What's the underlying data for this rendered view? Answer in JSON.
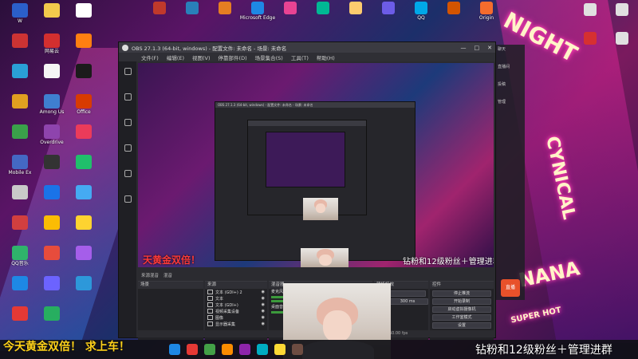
{
  "desktop": {
    "left_icons": [
      {
        "label": "W",
        "color": "#2b5fc9"
      },
      {
        "label": "",
        "color": "#c33"
      },
      {
        "label": "",
        "color": "#2a9fd6"
      },
      {
        "label": "",
        "color": "#e0a020"
      },
      {
        "label": "",
        "color": "#3aa04a"
      },
      {
        "label": "Mobile Ex",
        "color": "#4468c4"
      },
      {
        "label": "",
        "color": "#c9c9c9"
      },
      {
        "label": "",
        "color": "#d23f3f"
      },
      {
        "label": "QQ音乐",
        "color": "#2fb36b"
      },
      {
        "label": "",
        "color": "#1e88e5"
      },
      {
        "label": "",
        "color": "#e53935"
      },
      {
        "label": "",
        "color": "#f2c94c"
      },
      {
        "label": "网易云",
        "color": "#d32f2f"
      },
      {
        "label": "",
        "color": "#f5f5f5"
      },
      {
        "label": "Among Us",
        "color": "#3f7fd0"
      },
      {
        "label": "Overdrive",
        "color": "#8e44ad"
      },
      {
        "label": "",
        "color": "#333"
      },
      {
        "label": "",
        "color": "#1a73e8"
      },
      {
        "label": "",
        "color": "#fbbc04"
      },
      {
        "label": "",
        "color": "#e74c3c"
      },
      {
        "label": "",
        "color": "#6c63ff"
      },
      {
        "label": "",
        "color": "#27ae60"
      },
      {
        "label": "",
        "color": "#ffffff"
      },
      {
        "label": "",
        "color": "#ff7f11"
      },
      {
        "label": "",
        "color": "#1b1b1b"
      },
      {
        "label": "Office",
        "color": "#d83b01"
      },
      {
        "label": "",
        "color": "#eb3b5a"
      },
      {
        "label": "",
        "color": "#20bf6b"
      },
      {
        "label": "",
        "color": "#45aaf2"
      },
      {
        "label": "",
        "color": "#fed330"
      },
      {
        "label": "",
        "color": "#a55eea"
      },
      {
        "label": "",
        "color": "#2d98da"
      }
    ],
    "top_icons": [
      {
        "label": "",
        "color": "#c0392b"
      },
      {
        "label": "",
        "color": "#2980b9"
      },
      {
        "label": "",
        "color": "#e67e22"
      },
      {
        "label": "Microsoft Edge",
        "color": "#1e88e5"
      },
      {
        "label": "",
        "color": "#e84393"
      },
      {
        "label": "",
        "color": "#00b894"
      },
      {
        "label": "",
        "color": "#fdcb6e"
      },
      {
        "label": "",
        "color": "#6c5ce7"
      },
      {
        "label": "QQ",
        "color": "#00a8e8"
      },
      {
        "label": "",
        "color": "#d35400"
      },
      {
        "label": "Origin",
        "color": "#f56c2d"
      }
    ],
    "right_icons": [
      {
        "label": "",
        "color": "#e0e0e0"
      },
      {
        "label": "",
        "color": "#e0e0e0"
      },
      {
        "label": "",
        "color": "#d63031"
      },
      {
        "label": "",
        "color": "#e0e0e0"
      }
    ],
    "neon_words": [
      "NIGHT",
      "CYNICAL",
      "SUPER HOT",
      "NANA"
    ]
  },
  "obs": {
    "title": "OBS 27.1.3 (64-bit, windows) - 配置文件: 未命名 - 场景: 未命名",
    "window_controls": [
      "—",
      "□",
      "✕"
    ],
    "menu": [
      "文件(F)",
      "编辑(E)",
      "视图(V)",
      "停靠部件(D)",
      "场景集合(S)",
      "工具(T)",
      "帮助(H)"
    ],
    "dock_tabs": [
      "来源混音",
      "混音"
    ],
    "docks": {
      "scenes": {
        "title": "场景"
      },
      "sources": {
        "title": "来源",
        "items": [
          "文本 (GDI+) 2",
          "文本",
          "文本 (GDI+)",
          "视频采集设备",
          "图像",
          "显示器采集"
        ]
      },
      "mixer": {
        "title": "混音器",
        "channels": [
          "麦克风/Aux",
          "桌面音频"
        ]
      },
      "transitions": {
        "title": "转场特效",
        "type": "渐变",
        "duration_label": "时长",
        "duration": "300 ms"
      },
      "controls": {
        "title": "控件",
        "buttons": [
          "停止推流",
          "开始录制",
          "启动虚拟摄像机",
          "工作室模式",
          "设置",
          "退出"
        ]
      }
    },
    "status": "LIVE: 00:00:00   REC: 00:00:00   CPU: 3.9%, 60.00 fps"
  },
  "overlays": {
    "red_text": "天黄金双倍！",
    "yellow_bottom": "今天黄金双倍！ 求上车！",
    "white_bottom": "钻粉和12级粉丝＋管理进群",
    "white_mid": "钻粉和12级粉丝＋管理进群"
  },
  "right_app": {
    "items": [
      "聊天",
      "直播间",
      "投稿",
      "管理"
    ],
    "live_button": "直播"
  },
  "taskbar": {
    "icons": [
      {
        "color": "#1e88e5"
      },
      {
        "color": "#e53935"
      },
      {
        "color": "#43a047"
      },
      {
        "color": "#fb8c00"
      },
      {
        "color": "#8e24aa"
      },
      {
        "color": "#00acc1"
      },
      {
        "color": "#fdd835"
      },
      {
        "color": "#6d4c41"
      }
    ]
  }
}
